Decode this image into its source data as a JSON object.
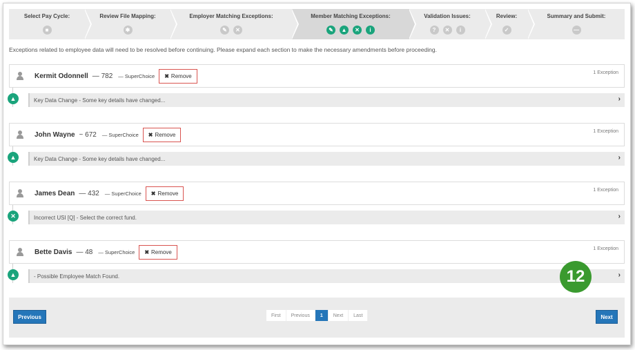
{
  "wizard": {
    "steps": [
      {
        "label": "Select Pay Cycle:",
        "icons": [
          "square"
        ],
        "active": false
      },
      {
        "label": "Review File Mapping:",
        "icons": [
          "gear"
        ],
        "active": false
      },
      {
        "label": "Employer Matching Exceptions:",
        "icons": [
          "pencil",
          "close"
        ],
        "active": false
      },
      {
        "label": "Member Matching Exceptions:",
        "icons": [
          "pencil",
          "warning",
          "close",
          "info"
        ],
        "active": true
      },
      {
        "label": "Validation Issues:",
        "icons": [
          "question",
          "close",
          "info"
        ],
        "active": false
      },
      {
        "label": "Review:",
        "icons": [
          "check"
        ],
        "active": false
      },
      {
        "label": "Summary and Submit:",
        "icons": [
          "minus"
        ],
        "active": false
      }
    ]
  },
  "intro": "Exceptions related to employee data will need to be resolved before continuing. Please expand each section to make the necessary amendments before proceeding.",
  "members": [
    {
      "name": "Kermit Odonnell",
      "number": "— 782",
      "fund": "— SuperChoice",
      "remove": "Remove",
      "count": "1 Exception",
      "status": "warning",
      "exception": "Key Data Change - Some key details have changed..."
    },
    {
      "name": "John Wayne",
      "number": "~ 672",
      "fund": "— SuperChoice",
      "remove": "Remove",
      "count": "1 Exception",
      "status": "warning",
      "exception": "Key Data Change - Some key details have changed..."
    },
    {
      "name": "James Dean",
      "number": "— 432",
      "fund": "— SuperChoice",
      "remove": "Remove",
      "count": "1 Exception",
      "status": "close",
      "exception": "Incorrect USI [Q] - Select the correct fund."
    },
    {
      "name": "Bette Davis",
      "number": "— 48",
      "fund": "— SuperChoice",
      "remove": "Remove",
      "count": "1 Exception",
      "status": "warning",
      "exception": "- Possible Employee Match Found."
    }
  ],
  "badge": "12",
  "footer": {
    "previous": "Previous",
    "next": "Next",
    "pager": {
      "first": "First",
      "previous": "Previous",
      "current": "1",
      "next": "Next",
      "last": "Last"
    }
  },
  "colors": {
    "accent": "#1aa47c",
    "primary": "#2576b9",
    "remove_border": "#d9534f",
    "badge": "#3a9a2f"
  }
}
